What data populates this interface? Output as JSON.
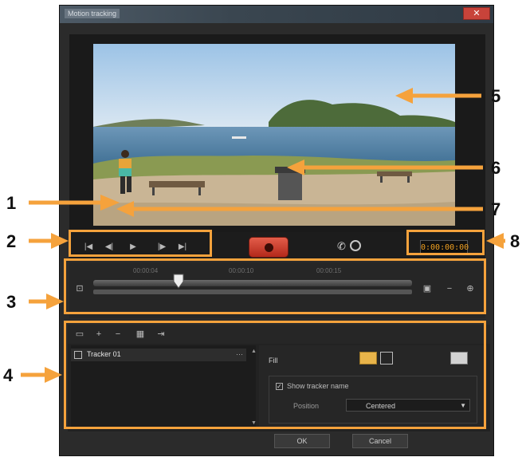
{
  "window": {
    "title": "Motion tracking"
  },
  "playback": {
    "timecode": "0:00:00:00"
  },
  "timeline": {
    "marks": [
      "00:00:04",
      "00:00:10",
      "00:00:15"
    ]
  },
  "objects": {
    "items": [
      {
        "label": "Tracker 01"
      }
    ]
  },
  "properties": {
    "fill_label": "Fill",
    "option_label": "Show tracker name",
    "select_label": "Position",
    "select_value": "Centered"
  },
  "footer": {
    "ok_label": "OK",
    "cancel_label": "Cancel"
  },
  "callouts": [
    "1",
    "2",
    "3",
    "4",
    "5",
    "6",
    "7",
    "8"
  ],
  "colors": {
    "callout": "#f5a23c",
    "record": "#d2402f",
    "timecode": "#f0a020"
  }
}
